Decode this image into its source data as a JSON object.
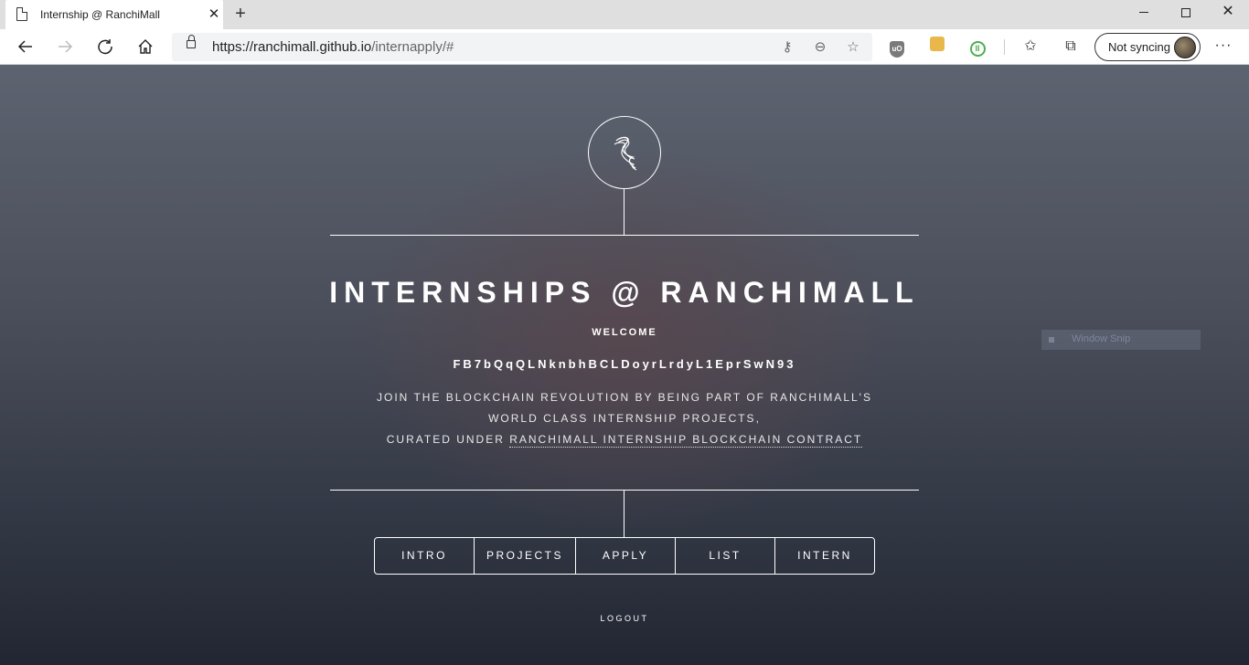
{
  "browser": {
    "tab_title": "Internship @ RanchiMall",
    "tab_close": "✕",
    "new_tab": "+",
    "url_host": "https://ranchimall.github.io",
    "url_path": "/internapply/#",
    "profile_label": "Not syncing",
    "more": "···",
    "window_close": "✕"
  },
  "page": {
    "title": "INTERNSHIPS @ RANCHIMALL",
    "welcome": "WELCOME",
    "flo_address": "FB7bQqQLNknbhBCLDoyrLrdyL1EprSwN93",
    "description_line1": "JOIN THE BLOCKCHAIN REVOLUTION BY BEING PART OF RANCHIMALL'S",
    "description_line2": "WORLD CLASS INTERNSHIP PROJECTS,",
    "description_line3_prefix": "CURATED UNDER ",
    "contract_link": "RANCHIMALL INTERNSHIP BLOCKCHAIN CONTRACT",
    "nav": [
      {
        "label": "INTRO"
      },
      {
        "label": "PROJECTS"
      },
      {
        "label": "APPLY"
      },
      {
        "label": "LIST"
      },
      {
        "label": "INTERN"
      }
    ],
    "logout": "LOGOUT"
  },
  "overlay": {
    "snip_label": "Window Snip"
  }
}
